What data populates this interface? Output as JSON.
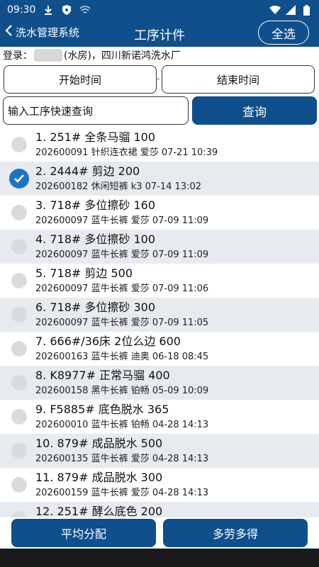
{
  "status": {
    "time": "09:30"
  },
  "header": {
    "back_label": "洗水管理系统",
    "title": "工序计件",
    "select_all": "全选"
  },
  "login": {
    "prefix": "登录：",
    "suffix": "(水房)，四川新诺鸿洗水厂"
  },
  "filters": {
    "start_time": "开始时间",
    "separator": "-",
    "end_time": "结束时间",
    "search_placeholder": "输入工序快速查询",
    "query": "查询"
  },
  "items": [
    {
      "line1": "1.  251# 全条马骝 100",
      "line2": "202600091 针织连衣裙 爱莎 07-21 10:39",
      "checked": false
    },
    {
      "line1": "2.  2444# 剪边 200",
      "line2": "202600182 休闲短裤 k3 07-14 13:02",
      "checked": true
    },
    {
      "line1": "3.  718# 多位擦砂 160",
      "line2": "202600097 蓝牛长裤 爱莎 07-09 11:09",
      "checked": false
    },
    {
      "line1": "4.  718# 多位擦砂 100",
      "line2": "202600097 蓝牛长裤 爱莎 07-09 11:09",
      "checked": false
    },
    {
      "line1": "5.  718# 剪边 500",
      "line2": "202600097 蓝牛长裤 爱莎 07-09 11:06",
      "checked": false
    },
    {
      "line1": "6.  718# 多位擦砂 300",
      "line2": "202600097 蓝牛长裤 爱莎 07-09 11:05",
      "checked": false
    },
    {
      "line1": "7.  666#/36床 2位么边 600",
      "line2": "202600163 蓝牛长裤 迪奥 06-18 08:45",
      "checked": false
    },
    {
      "line1": "8.  K8977# 正常马骝 400",
      "line2": "202600158 黑牛长裤 铂畅 05-09 10:09",
      "checked": false
    },
    {
      "line1": "9.  F5885# 底色脱水 365",
      "line2": "202600010 蓝牛长裤 铂畅 04-28 14:13",
      "checked": false
    },
    {
      "line1": "10.  879# 成品脱水 500",
      "line2": "202600135 蓝牛长裤 爱莎 04-28 14:13",
      "checked": false
    },
    {
      "line1": "11.  879# 成品脱水 300",
      "line2": "202600159 蓝牛长裤 爱莎 04-28 14:13",
      "checked": false
    },
    {
      "line1": "12.  251# 酵么底色 200",
      "line2": "",
      "checked": false
    }
  ],
  "bottom": {
    "average": "平均分配",
    "more_work": "多劳多得"
  },
  "colors": {
    "primary": "#0f4f8c",
    "alt_row": "#e7eaee",
    "checked": "#1f73c7"
  }
}
